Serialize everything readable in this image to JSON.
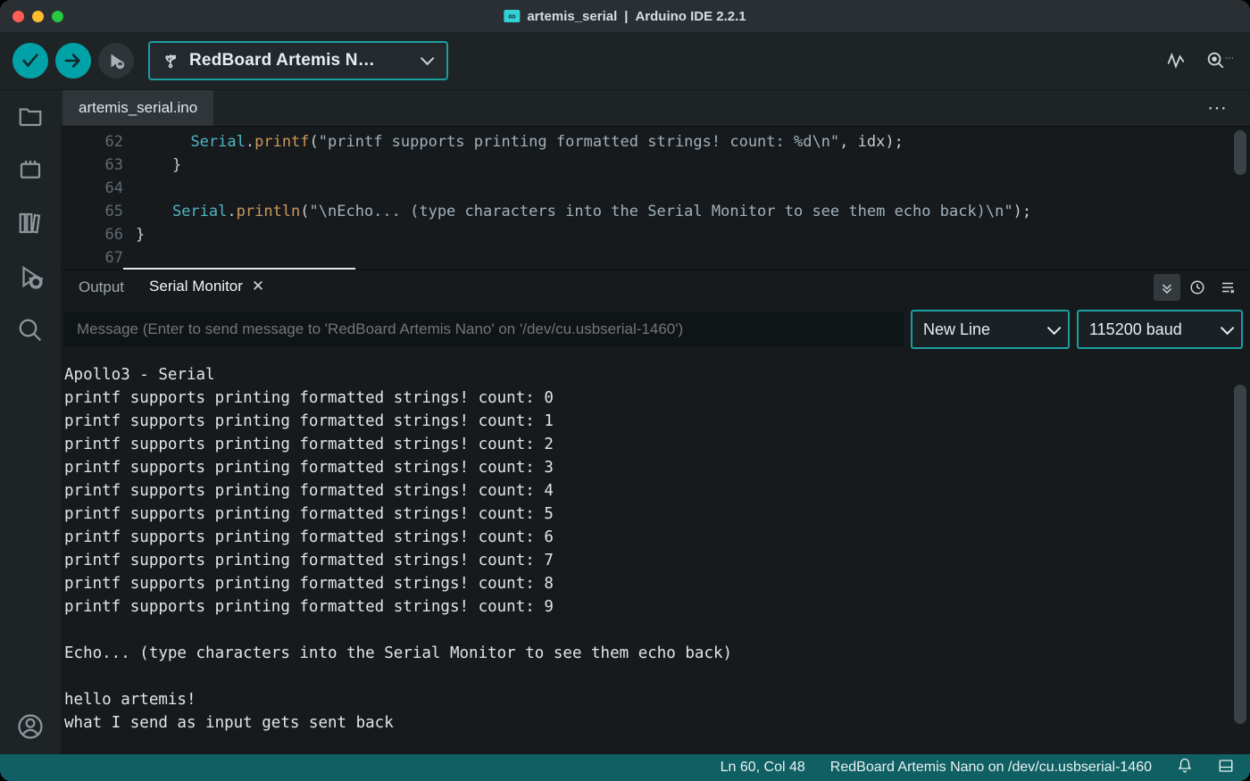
{
  "window": {
    "title_sketch": "artemis_serial",
    "title_app": "Arduino IDE 2.2.1"
  },
  "toolbar": {
    "board_label": "RedBoard Artemis N…"
  },
  "sidebar": {},
  "tabs": {
    "file_tab": "artemis_serial.ino"
  },
  "editor": {
    "gutter": [
      "62",
      "63",
      "64",
      "65",
      "66",
      "67"
    ],
    "l62_obj": "Serial",
    "l62_fn": "printf",
    "l62_str": "\"printf supports printing formatted strings! count: %d\\n\"",
    "l62_rest": ", idx);",
    "l63": "    }",
    "l64": "",
    "l65_obj": "Serial",
    "l65_fn": "println",
    "l65_str": "\"\\nEcho... (type characters into the Serial Monitor to see them echo back)\\n\"",
    "l65_rest": ");",
    "l66": "}",
    "l67": ""
  },
  "panel": {
    "tabs": {
      "output": "Output",
      "serial": "Serial Monitor"
    },
    "message_placeholder": "Message (Enter to send message to 'RedBoard Artemis Nano' on '/dev/cu.usbserial-1460')",
    "line_ending": "New Line",
    "baud": "115200 baud",
    "serial_text": "Apollo3 - Serial\nprintf supports printing formatted strings! count: 0\nprintf supports printing formatted strings! count: 1\nprintf supports printing formatted strings! count: 2\nprintf supports printing formatted strings! count: 3\nprintf supports printing formatted strings! count: 4\nprintf supports printing formatted strings! count: 5\nprintf supports printing formatted strings! count: 6\nprintf supports printing formatted strings! count: 7\nprintf supports printing formatted strings! count: 8\nprintf supports printing formatted strings! count: 9\n\nEcho... (type characters into the Serial Monitor to see them echo back)\n\nhello artemis!\nwhat I send as input gets sent back"
  },
  "status": {
    "cursor": "Ln 60, Col 48",
    "board_info": "RedBoard Artemis Nano on /dev/cu.usbserial-1460"
  }
}
